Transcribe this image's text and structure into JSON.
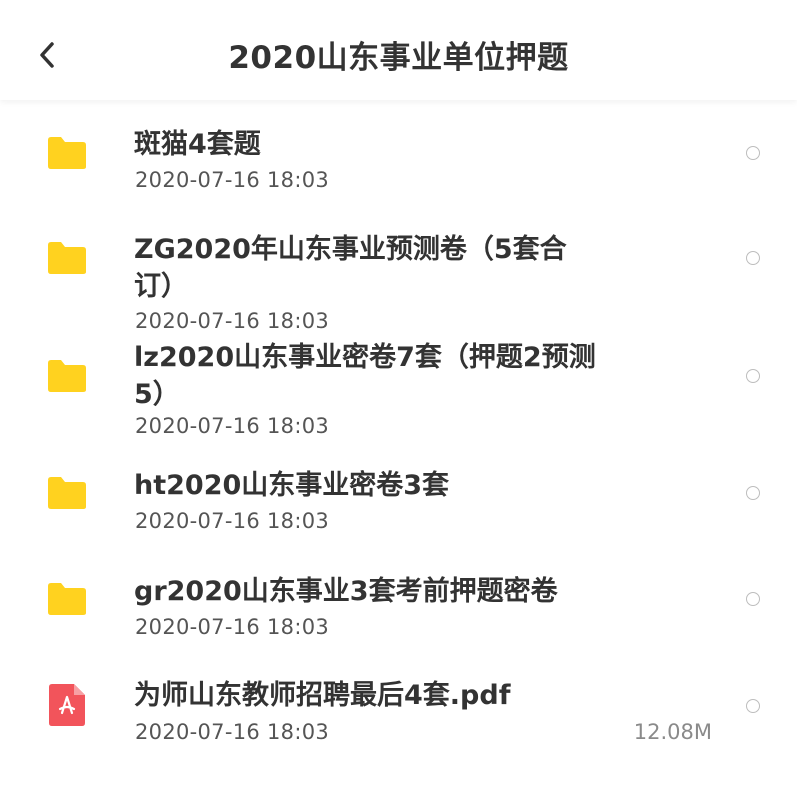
{
  "header": {
    "title": "2020山东事业单位押题"
  },
  "files": [
    {
      "name": "斑猫4套题",
      "date": "2020-07-16 18:03",
      "icon": "folder-icon",
      "size": ""
    },
    {
      "name": "ZG2020年山东事业预测卷（5套合订）",
      "date": "2020-07-16 18:03",
      "icon": "folder-icon",
      "size": ""
    },
    {
      "name": "lz2020山东事业密卷7套（押题2预测5）",
      "date": "2020-07-16 18:03",
      "icon": "folder-icon",
      "size": ""
    },
    {
      "name": "ht2020山东事业密卷3套",
      "date": "2020-07-16 18:03",
      "icon": "folder-icon",
      "size": ""
    },
    {
      "name": "gr2020山东事业3套考前押题密卷",
      "date": "2020-07-16 18:03",
      "icon": "folder-icon",
      "size": ""
    },
    {
      "name": "为师山东教师招聘最后4套.pdf",
      "date": "2020-07-16 18:03",
      "icon": "pdf-icon",
      "size": "12.08M"
    }
  ],
  "colors": {
    "folder": "#FFD21F",
    "pdf": "#F2545B",
    "text": "#333333",
    "meta": "#555555"
  }
}
